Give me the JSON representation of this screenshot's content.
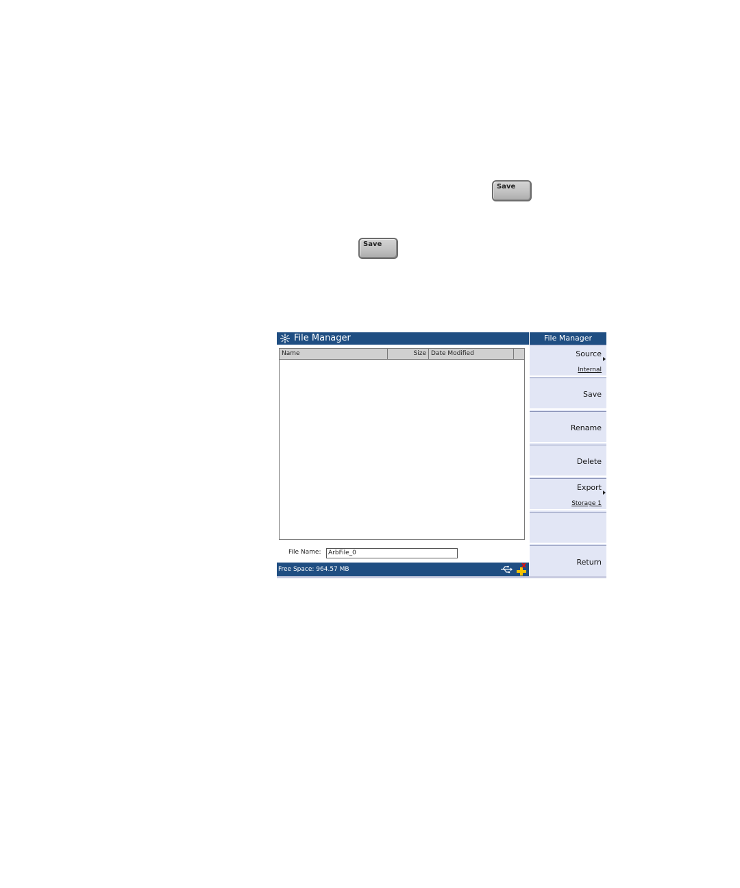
{
  "hardware_keys": {
    "save_key_1": "Save",
    "save_key_2": "Save"
  },
  "window": {
    "title": "File Manager",
    "title_icon": "agilent-spark-icon"
  },
  "file_list": {
    "columns": [
      "Name",
      "Size",
      "Date Modified",
      ""
    ],
    "rows": []
  },
  "file_name": {
    "label": "File Name:",
    "value": "ArbFile_0"
  },
  "status_bar": {
    "free_space": "Free Space: 964.57 MB",
    "icons": [
      "usb-icon",
      "lan-disconnected-icon"
    ]
  },
  "softkeys": {
    "title": "File Manager",
    "items": [
      {
        "label": "Source",
        "sub": "Internal",
        "has_submenu": true
      },
      {
        "label": "Save",
        "sub": "",
        "has_submenu": false
      },
      {
        "label": "Rename",
        "sub": "",
        "has_submenu": false
      },
      {
        "label": "Delete",
        "sub": "",
        "has_submenu": false
      },
      {
        "label": "Export",
        "sub": "Storage 1",
        "has_submenu": true
      },
      {
        "label": "",
        "sub": "",
        "has_submenu": false
      },
      {
        "label": "Return",
        "sub": "",
        "has_submenu": false
      }
    ]
  },
  "colors": {
    "title_bar": "#1f4e82",
    "softkey_bg": "#e2e6f5"
  }
}
